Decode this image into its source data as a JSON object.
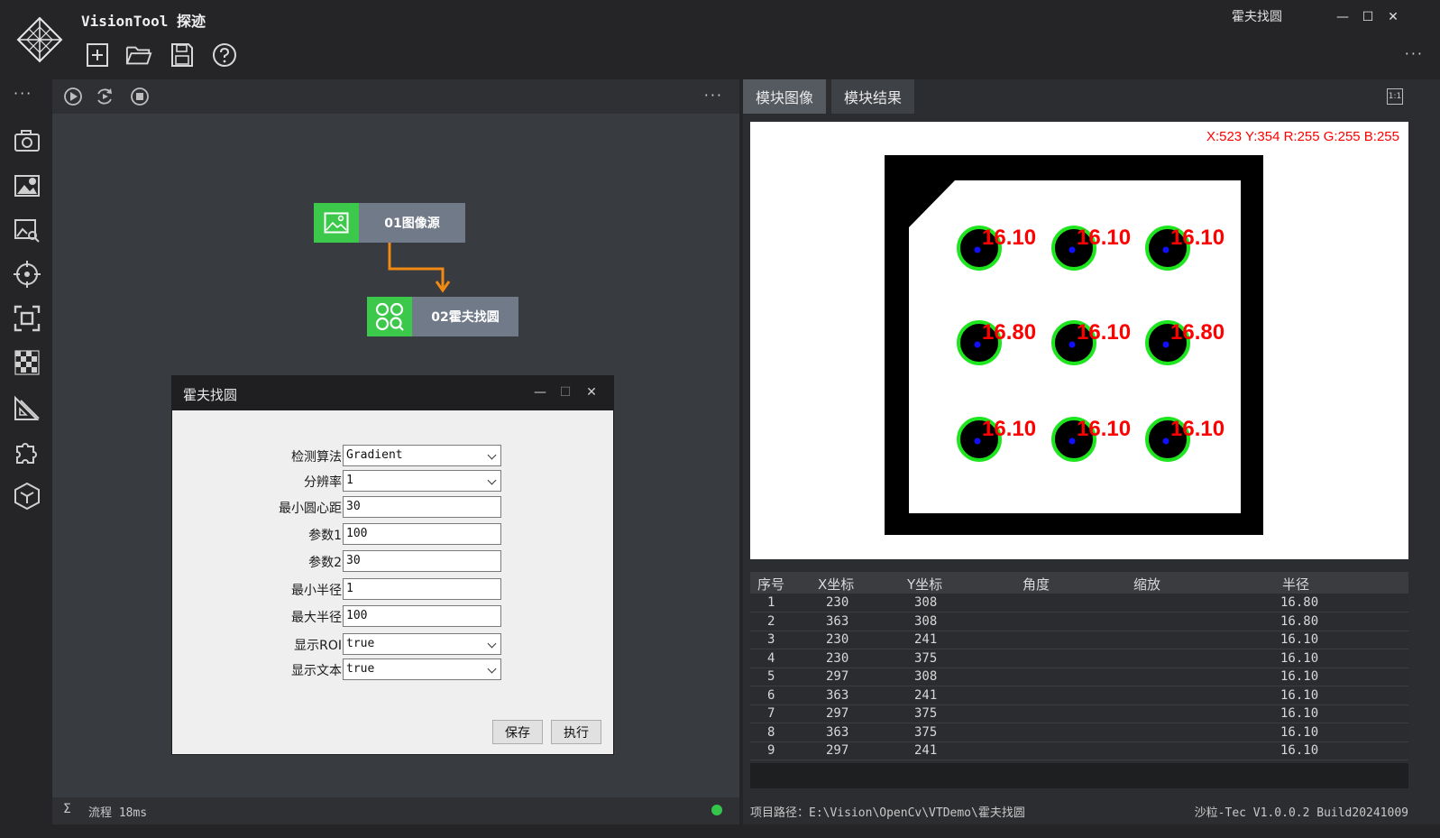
{
  "app": {
    "title": "VisionTool 探迹",
    "window_title": "霍夫找圆",
    "window_controls": {
      "minimize": "—",
      "maximize": "☐",
      "close": "✕"
    },
    "more": "···"
  },
  "toolbar": {
    "icons": [
      "new-icon",
      "open-folder-icon",
      "save-icon",
      "help-icon"
    ]
  },
  "toolstrip": {
    "more": "···",
    "icons": [
      "camera-icon",
      "image-settings-icon",
      "image-search-icon",
      "crosshair-icon",
      "focus-frame-icon",
      "checkerboard-icon",
      "ruler-icon",
      "puzzle-icon",
      "cube-icon"
    ]
  },
  "flow": {
    "more": "···",
    "controls": [
      "run-once-icon",
      "run-loop-icon",
      "stop-icon"
    ],
    "nodes": [
      {
        "label": "01图像源",
        "icon": "image-icon"
      },
      {
        "label": "02霍夫找圆",
        "icon": "circles-search-icon"
      }
    ],
    "status": {
      "sigma": "Σ",
      "text": "流程 18ms"
    }
  },
  "dialog": {
    "title": "霍夫找圆",
    "params": [
      {
        "label": "检测算法",
        "value": "Gradient",
        "select": true
      },
      {
        "label": "分辨率",
        "value": "1",
        "select": true
      },
      {
        "label": "最小圆心距",
        "value": "30",
        "select": false
      },
      {
        "label": "参数1",
        "value": "100",
        "select": false
      },
      {
        "label": "参数2",
        "value": "30",
        "select": false
      },
      {
        "label": "最小半径",
        "value": "1",
        "select": false
      },
      {
        "label": "最大半径",
        "value": "100",
        "select": false
      },
      {
        "label": "显示ROI",
        "value": "true",
        "select": true
      },
      {
        "label": "显示文本",
        "value": "true",
        "select": true
      }
    ],
    "save": "保存",
    "execute": "执行"
  },
  "right": {
    "tabs": [
      "模块图像",
      "模块结果"
    ],
    "ratio": "1:1",
    "pixel_info": "X:523 Y:354  R:255 G:255 B:255",
    "circle_labels": [
      [
        "16.10",
        "16.10",
        "16.10"
      ],
      [
        "16.80",
        "16.10",
        "16.80"
      ],
      [
        "16.10",
        "16.10",
        "16.10"
      ]
    ],
    "table": {
      "headers": [
        "序号",
        "X坐标",
        "Y坐标",
        "角度",
        "缩放",
        "半径"
      ],
      "rows": [
        [
          "1",
          "230",
          "308",
          "",
          "",
          "16.80"
        ],
        [
          "2",
          "363",
          "308",
          "",
          "",
          "16.80"
        ],
        [
          "3",
          "230",
          "241",
          "",
          "",
          "16.10"
        ],
        [
          "4",
          "230",
          "375",
          "",
          "",
          "16.10"
        ],
        [
          "5",
          "297",
          "308",
          "",
          "",
          "16.10"
        ],
        [
          "6",
          "363",
          "241",
          "",
          "",
          "16.10"
        ],
        [
          "7",
          "297",
          "375",
          "",
          "",
          "16.10"
        ],
        [
          "8",
          "363",
          "375",
          "",
          "",
          "16.10"
        ],
        [
          "9",
          "297",
          "241",
          "",
          "",
          "16.10"
        ]
      ]
    },
    "project_path": "项目路径：E:\\Vision\\OpenCv\\VTDemo\\霍夫找圆",
    "version": "沙粒-Tec V1.0.0.2 Build20241009"
  },
  "colors": {
    "node_icon_green": "#3cc84a",
    "connector_orange": "#f08a12",
    "circle_green": "#1ee61e",
    "label_red": "#ff0000"
  }
}
